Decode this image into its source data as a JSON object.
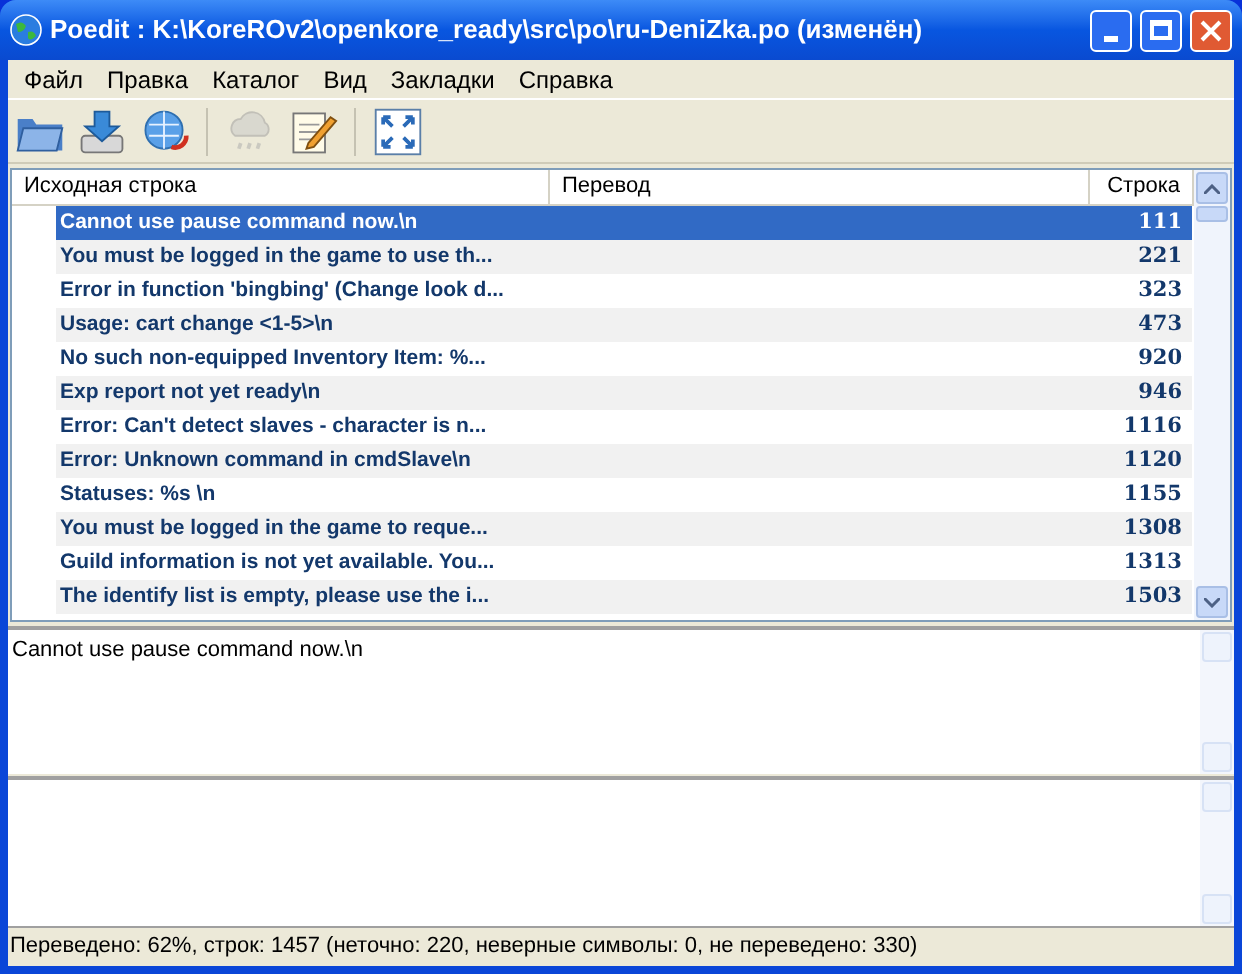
{
  "window": {
    "title": "Poedit : K:\\KoreROv2\\openkore_ready\\src\\po\\ru-DeniZka.po (изменён)"
  },
  "menu": [
    "Файл",
    "Правка",
    "Каталог",
    "Вид",
    "Закладки",
    "Справка"
  ],
  "toolbar": [
    {
      "kind": "open",
      "disabled": false
    },
    {
      "kind": "save",
      "disabled": false
    },
    {
      "kind": "update",
      "disabled": false
    },
    {
      "kind": "sep"
    },
    {
      "kind": "cloud",
      "disabled": true
    },
    {
      "kind": "notes",
      "disabled": false
    },
    {
      "kind": "sep"
    },
    {
      "kind": "fullscreen",
      "disabled": false
    }
  ],
  "table": {
    "columns": [
      "Исходная строка",
      "Перевод",
      "Строка"
    ],
    "rows": [
      {
        "source": "Cannot use pause command now.\\n",
        "line": "111",
        "selected": true
      },
      {
        "source": "You must be logged in the game to use th...",
        "line": "221",
        "selected": false
      },
      {
        "source": "Error in function 'bingbing' (Change look d...",
        "line": "323",
        "selected": false
      },
      {
        "source": "Usage: cart change <1-5>\\n",
        "line": "473",
        "selected": false
      },
      {
        "source": "No such non-equipped Inventory Item: %...",
        "line": "920",
        "selected": false
      },
      {
        "source": "Exp report not yet ready\\n",
        "line": "946",
        "selected": false
      },
      {
        "source": "Error: Can't detect slaves - character is n...",
        "line": "1116",
        "selected": false
      },
      {
        "source": "Error: Unknown command in cmdSlave\\n",
        "line": "1120",
        "selected": false
      },
      {
        "source": "Statuses: %s \\n",
        "line": "1155",
        "selected": false
      },
      {
        "source": "You must be logged in the game to reque...",
        "line": "1308",
        "selected": false
      },
      {
        "source": "Guild information is not yet available. You...",
        "line": "1313",
        "selected": false
      },
      {
        "source": "The identify list is empty, please use the i...",
        "line": "1503",
        "selected": false
      }
    ]
  },
  "source_editor": {
    "value": "Cannot use pause command now.\\n"
  },
  "status_bar": "Переведено: 62%, строк: 1457 (неточно: 220, неверные символы: 0, не переведено: 330)"
}
